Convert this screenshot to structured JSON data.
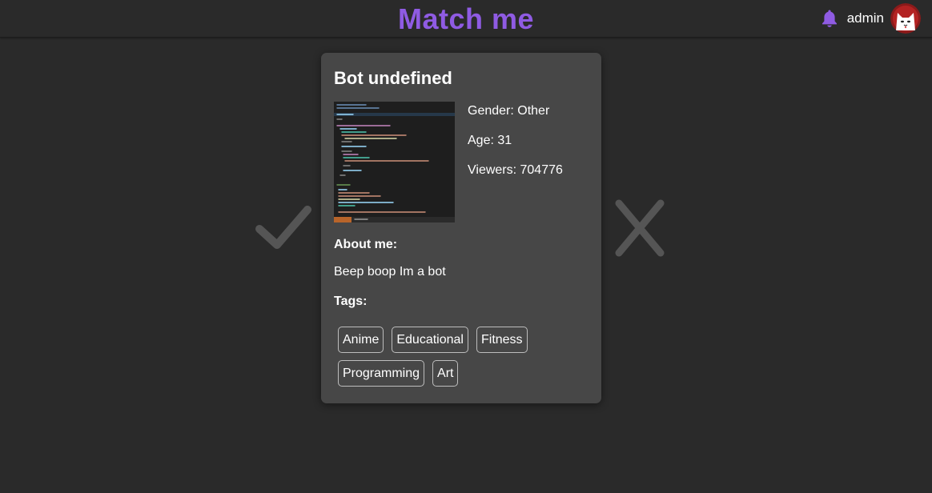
{
  "header": {
    "title": "Match me",
    "username": "admin",
    "bell_icon": "bell-icon",
    "accent_color": "#8f5be3"
  },
  "actions": {
    "like_icon": "checkmark-icon",
    "dislike_icon": "x-icon"
  },
  "profile": {
    "name": "Bot undefined",
    "gender": "Gender: Other",
    "age": "Age: 31",
    "viewers": "Viewers: 704776",
    "about_label": "About me:",
    "about_text": "Beep boop Im a bot",
    "tags_label": "Tags:",
    "tags": [
      "Anime",
      "Educational",
      "Fitness",
      "Programming",
      "Art"
    ]
  }
}
